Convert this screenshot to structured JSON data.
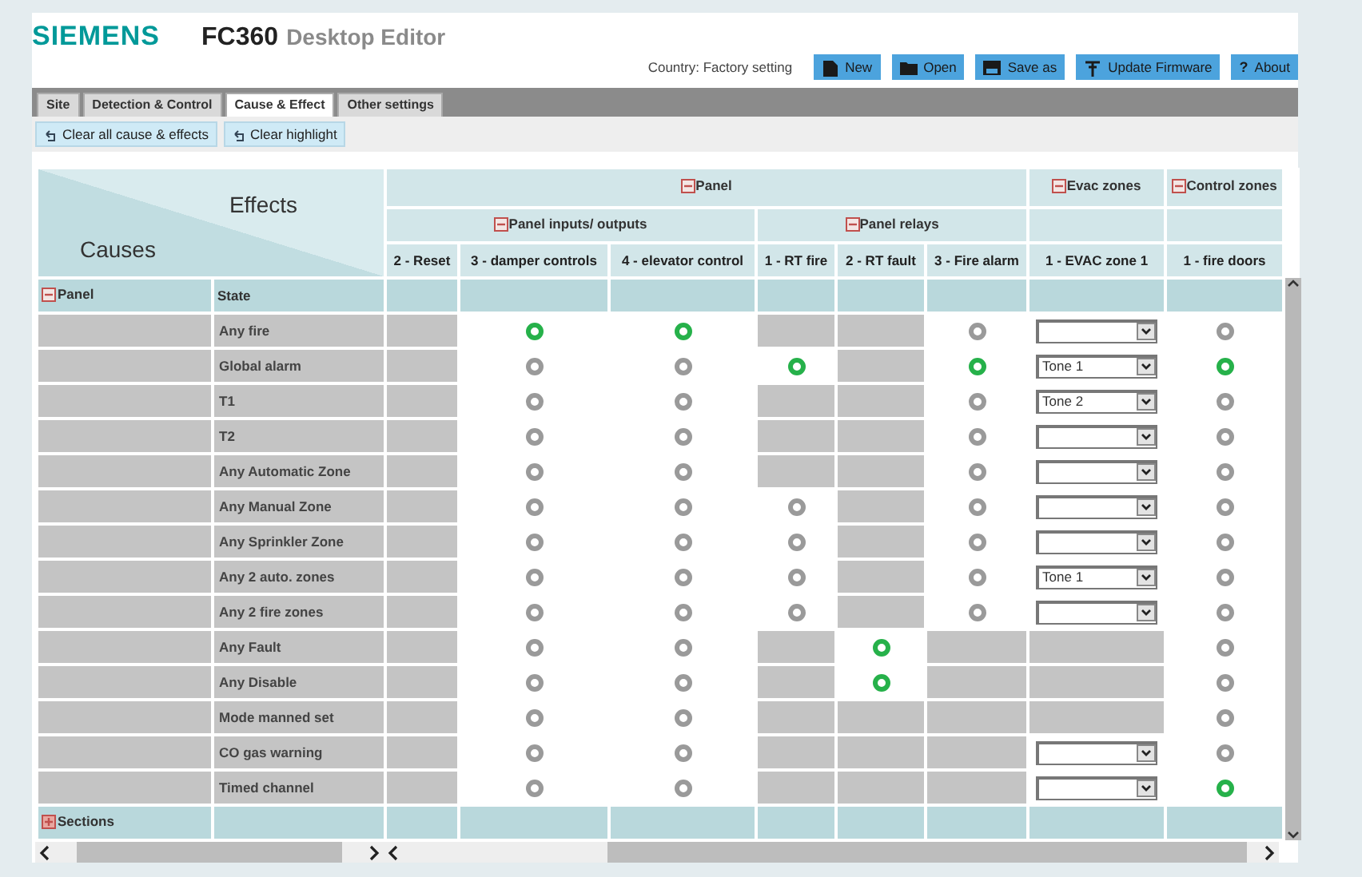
{
  "app": {
    "brand": "SIEMENS",
    "product": "FC360",
    "subtitle": "Desktop Editor"
  },
  "country": "Country: Factory setting",
  "toolbar": [
    {
      "label": "New"
    },
    {
      "label": "Open"
    },
    {
      "label": "Save as"
    },
    {
      "label": "Update Firmware"
    },
    {
      "label": "About",
      "glyph": "?"
    }
  ],
  "tabs": [
    {
      "label": "Site",
      "selected": false
    },
    {
      "label": "Detection & Control",
      "selected": false
    },
    {
      "label": "Cause & Effect",
      "selected": true
    },
    {
      "label": "Other settings",
      "selected": false
    }
  ],
  "actions": [
    "Clear all cause & effects",
    "Clear highlight"
  ],
  "matrix": {
    "corner_top": "Effects",
    "corner_bottom": "Causes",
    "groups": [
      {
        "label": "Panel",
        "expanded": true,
        "subgroups": [
          {
            "label": "Panel inputs/ outputs",
            "expanded": true,
            "columns": [
              "2 - Reset",
              "3 - damper controls",
              "4 - elevator control"
            ]
          },
          {
            "label": "Panel relays",
            "expanded": true,
            "columns": [
              "1 - RT fire",
              "2 - RT fault",
              "3 - Fire alarm"
            ]
          }
        ]
      },
      {
        "label": "Evac zones",
        "expanded": true,
        "subgroups": [
          {
            "columns": [
              "1 - EVAC zone 1"
            ]
          }
        ]
      },
      {
        "label": "Control zones",
        "expanded": true,
        "subgroups": [
          {
            "columns": [
              "1 - fire doors"
            ]
          }
        ]
      }
    ],
    "sections": [
      {
        "label": "Panel",
        "expanded": true,
        "state_label": "State",
        "rows": [
          {
            "label": "Any fire",
            "cells": [
              {
                "kind": "blocked"
              },
              {
                "kind": "indicator",
                "on": true
              },
              {
                "kind": "indicator",
                "on": true
              },
              {
                "kind": "blocked"
              },
              {
                "kind": "blocked"
              },
              {
                "kind": "indicator",
                "on": false
              },
              {
                "kind": "dropdown"
              },
              {
                "kind": "indicator",
                "on": false
              }
            ]
          },
          {
            "label": "Global alarm",
            "cells": [
              {
                "kind": "blocked"
              },
              {
                "kind": "indicator",
                "on": false
              },
              {
                "kind": "indicator",
                "on": false
              },
              {
                "kind": "indicator",
                "on": true
              },
              {
                "kind": "blocked"
              },
              {
                "kind": "indicator",
                "on": true
              },
              {
                "kind": "dropdown",
                "value": "Tone 1"
              },
              {
                "kind": "indicator",
                "on": true
              }
            ]
          },
          {
            "label": "T1",
            "cells": [
              {
                "kind": "blocked"
              },
              {
                "kind": "indicator",
                "on": false
              },
              {
                "kind": "indicator",
                "on": false
              },
              {
                "kind": "blocked"
              },
              {
                "kind": "blocked"
              },
              {
                "kind": "indicator",
                "on": false
              },
              {
                "kind": "dropdown",
                "value": "Tone 2"
              },
              {
                "kind": "indicator",
                "on": false
              }
            ]
          },
          {
            "label": "T2",
            "cells": [
              {
                "kind": "blocked"
              },
              {
                "kind": "indicator",
                "on": false
              },
              {
                "kind": "indicator",
                "on": false
              },
              {
                "kind": "blocked"
              },
              {
                "kind": "blocked"
              },
              {
                "kind": "indicator",
                "on": false
              },
              {
                "kind": "dropdown"
              },
              {
                "kind": "indicator",
                "on": false
              }
            ]
          },
          {
            "label": "Any Automatic Zone",
            "cells": [
              {
                "kind": "blocked"
              },
              {
                "kind": "indicator",
                "on": false
              },
              {
                "kind": "indicator",
                "on": false
              },
              {
                "kind": "blocked"
              },
              {
                "kind": "blocked"
              },
              {
                "kind": "indicator",
                "on": false
              },
              {
                "kind": "dropdown"
              },
              {
                "kind": "indicator",
                "on": false
              }
            ]
          },
          {
            "label": "Any Manual Zone",
            "cells": [
              {
                "kind": "blocked"
              },
              {
                "kind": "indicator",
                "on": false
              },
              {
                "kind": "indicator",
                "on": false
              },
              {
                "kind": "indicator",
                "on": false
              },
              {
                "kind": "blocked"
              },
              {
                "kind": "indicator",
                "on": false
              },
              {
                "kind": "dropdown"
              },
              {
                "kind": "indicator",
                "on": false
              }
            ]
          },
          {
            "label": "Any Sprinkler Zone",
            "cells": [
              {
                "kind": "blocked"
              },
              {
                "kind": "indicator",
                "on": false
              },
              {
                "kind": "indicator",
                "on": false
              },
              {
                "kind": "indicator",
                "on": false
              },
              {
                "kind": "blocked"
              },
              {
                "kind": "indicator",
                "on": false
              },
              {
                "kind": "dropdown"
              },
              {
                "kind": "indicator",
                "on": false
              }
            ]
          },
          {
            "label": "Any 2 auto. zones",
            "cells": [
              {
                "kind": "blocked"
              },
              {
                "kind": "indicator",
                "on": false
              },
              {
                "kind": "indicator",
                "on": false
              },
              {
                "kind": "indicator",
                "on": false
              },
              {
                "kind": "blocked"
              },
              {
                "kind": "indicator",
                "on": false
              },
              {
                "kind": "dropdown",
                "value": "Tone 1"
              },
              {
                "kind": "indicator",
                "on": false
              }
            ]
          },
          {
            "label": "Any 2 fire zones",
            "cells": [
              {
                "kind": "blocked"
              },
              {
                "kind": "indicator",
                "on": false
              },
              {
                "kind": "indicator",
                "on": false
              },
              {
                "kind": "indicator",
                "on": false
              },
              {
                "kind": "blocked"
              },
              {
                "kind": "indicator",
                "on": false
              },
              {
                "kind": "dropdown"
              },
              {
                "kind": "indicator",
                "on": false
              }
            ]
          },
          {
            "label": "Any Fault",
            "cells": [
              {
                "kind": "blocked"
              },
              {
                "kind": "indicator",
                "on": false
              },
              {
                "kind": "indicator",
                "on": false
              },
              {
                "kind": "blocked"
              },
              {
                "kind": "indicator",
                "on": true
              },
              {
                "kind": "blocked"
              },
              {
                "kind": "blocked"
              },
              {
                "kind": "indicator",
                "on": false
              }
            ]
          },
          {
            "label": "Any Disable",
            "cells": [
              {
                "kind": "blocked"
              },
              {
                "kind": "indicator",
                "on": false
              },
              {
                "kind": "indicator",
                "on": false
              },
              {
                "kind": "blocked"
              },
              {
                "kind": "indicator",
                "on": true
              },
              {
                "kind": "blocked"
              },
              {
                "kind": "blocked"
              },
              {
                "kind": "indicator",
                "on": false
              }
            ]
          },
          {
            "label": "Mode manned set",
            "cells": [
              {
                "kind": "blocked"
              },
              {
                "kind": "indicator",
                "on": false
              },
              {
                "kind": "indicator",
                "on": false
              },
              {
                "kind": "blocked"
              },
              {
                "kind": "blocked"
              },
              {
                "kind": "blocked"
              },
              {
                "kind": "blocked"
              },
              {
                "kind": "indicator",
                "on": false
              }
            ]
          },
          {
            "label": "CO gas warning",
            "cells": [
              {
                "kind": "blocked"
              },
              {
                "kind": "indicator",
                "on": false
              },
              {
                "kind": "indicator",
                "on": false
              },
              {
                "kind": "blocked"
              },
              {
                "kind": "blocked"
              },
              {
                "kind": "blocked"
              },
              {
                "kind": "dropdown"
              },
              {
                "kind": "indicator",
                "on": false
              }
            ]
          },
          {
            "label": "Timed channel",
            "cells": [
              {
                "kind": "blocked"
              },
              {
                "kind": "indicator",
                "on": false
              },
              {
                "kind": "indicator",
                "on": false
              },
              {
                "kind": "blocked"
              },
              {
                "kind": "blocked"
              },
              {
                "kind": "blocked"
              },
              {
                "kind": "dropdown"
              },
              {
                "kind": "indicator",
                "on": true
              }
            ]
          }
        ]
      },
      {
        "label": "Sections",
        "expanded": false
      }
    ]
  }
}
